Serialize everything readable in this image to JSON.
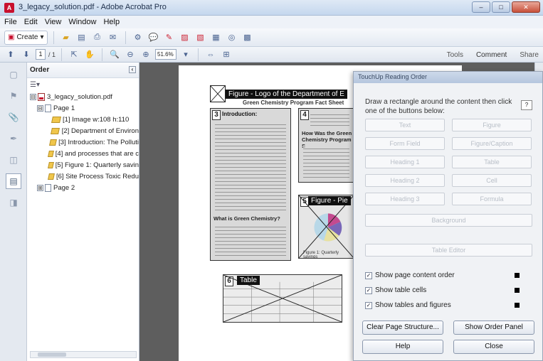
{
  "window": {
    "title": "3_legacy_solution.pdf - Adobe Acrobat Pro",
    "app_icon": "acrobat-icon",
    "buttons": [
      "minimize",
      "maximize",
      "close"
    ]
  },
  "menu": {
    "items": [
      "File",
      "Edit",
      "View",
      "Window",
      "Help"
    ]
  },
  "toolbar": {
    "create_label": "Create",
    "zoom": "51.6%",
    "page_current": "1",
    "page_total": "/ 1",
    "right_tabs": [
      "Tools",
      "Comment",
      "Share"
    ]
  },
  "orders_panel": {
    "title": "Order",
    "tree": [
      {
        "label": "3_legacy_solution.pdf",
        "kind": "pdf",
        "indent": 0,
        "expander": "⊟"
      },
      {
        "label": "Page 1",
        "kind": "page",
        "indent": 1,
        "expander": "⊟"
      },
      {
        "label": "[1] Image  w:108 h:110",
        "kind": "tag",
        "indent": 2
      },
      {
        "label": "[2] Department of Environ",
        "kind": "tag",
        "indent": 2
      },
      {
        "label": "[3] Introduction: The Polluti",
        "kind": "tag",
        "indent": 2
      },
      {
        "label": "[4] and processes that are c",
        "kind": "tag",
        "indent": 2
      },
      {
        "label": "[5] Figure 1: Quarterly savin",
        "kind": "tag",
        "indent": 2
      },
      {
        "label": "[6] Site Process Toxic Redu",
        "kind": "tag",
        "indent": 2
      },
      {
        "label": "Page 2",
        "kind": "page",
        "indent": 1,
        "expander": "⊞"
      }
    ]
  },
  "document": {
    "figure_logo_label": "Figure - Logo of the Department of E",
    "header_text": "Green Chemistry Program Fact Sheet",
    "box3_heading": "Introduction:",
    "box3_subheading": "What is Green Chemistry?",
    "box4_heading": "How Was the Green Chemistry Program S",
    "figure_pie_label": "Figure - Pie",
    "figure_pie_caption": "Figure 1: Quarterly savings",
    "table_label": "Table",
    "box_numbers": {
      "b3": "3",
      "b4": "4",
      "b5": "5",
      "b6": "6"
    }
  },
  "dialog": {
    "title": "TouchUp Reading Order",
    "instruction": "Draw a rectangle around the content then click one of the buttons below:",
    "grid_buttons": [
      [
        "Text",
        "Figure"
      ],
      [
        "Form Field",
        "Figure/Caption"
      ],
      [
        "Heading 1",
        "Table"
      ],
      [
        "Heading 2",
        "Cell"
      ],
      [
        "Heading 3",
        "Formula"
      ]
    ],
    "background_button": "Background",
    "table_editor_button": "Table Editor",
    "checks": [
      {
        "label": "Show page content order",
        "checked": true
      },
      {
        "label": "Show table cells",
        "checked": true
      },
      {
        "label": "Show tables and figures",
        "checked": true
      }
    ],
    "clear_button": "Clear Page Structure...",
    "show_order_button": "Show Order Panel",
    "help_button": "Help",
    "close_button": "Close"
  }
}
